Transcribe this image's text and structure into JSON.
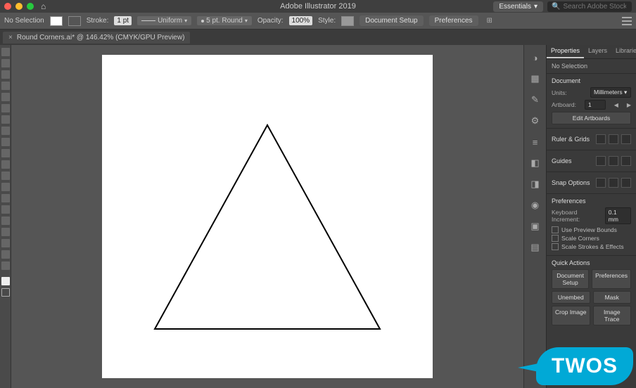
{
  "titlebar": {
    "app_title": "Adobe Illustrator 2019"
  },
  "workspace": {
    "label": "Essentials",
    "search_placeholder": "Search Adobe Stock"
  },
  "controlbar": {
    "no_selection": "No Selection",
    "stroke_label": "Stroke:",
    "stroke_weight": "1 pt",
    "stroke_profile": "Uniform",
    "brush_label": "5 pt. Round",
    "opacity_label": "Opacity:",
    "opacity_value": "100%",
    "style_label": "Style:",
    "doc_setup": "Document Setup",
    "preferences": "Preferences"
  },
  "tab": {
    "title": "Round Corners.ai* @ 146.42% (CMYK/GPU Preview)"
  },
  "panel": {
    "tabs": {
      "properties": "Properties",
      "layers": "Layers",
      "libraries": "Libraries"
    },
    "selection_state": "No Selection",
    "document": {
      "head": "Document",
      "units_label": "Units:",
      "units_value": "Millimeters",
      "artboard_label": "Artboard:",
      "artboard_value": "1",
      "edit_btn": "Edit Artboards"
    },
    "ruler": {
      "head": "Ruler & Grids"
    },
    "guides": {
      "head": "Guides"
    },
    "snap": {
      "head": "Snap Options"
    },
    "prefs": {
      "head": "Preferences",
      "kbd_label": "Keyboard Increment:",
      "kbd_value": "0.1 mm",
      "chk1": "Use Preview Bounds",
      "chk2": "Scale Corners",
      "chk3": "Scale Strokes & Effects"
    },
    "actions": {
      "head": "Quick Actions",
      "doc_setup": "Document Setup",
      "preferences": "Preferences",
      "unembed": "Unembed",
      "mask": "Mask",
      "crop": "Crop Image",
      "trace": "Image Trace"
    }
  },
  "watermark": {
    "text": "TWOS"
  }
}
